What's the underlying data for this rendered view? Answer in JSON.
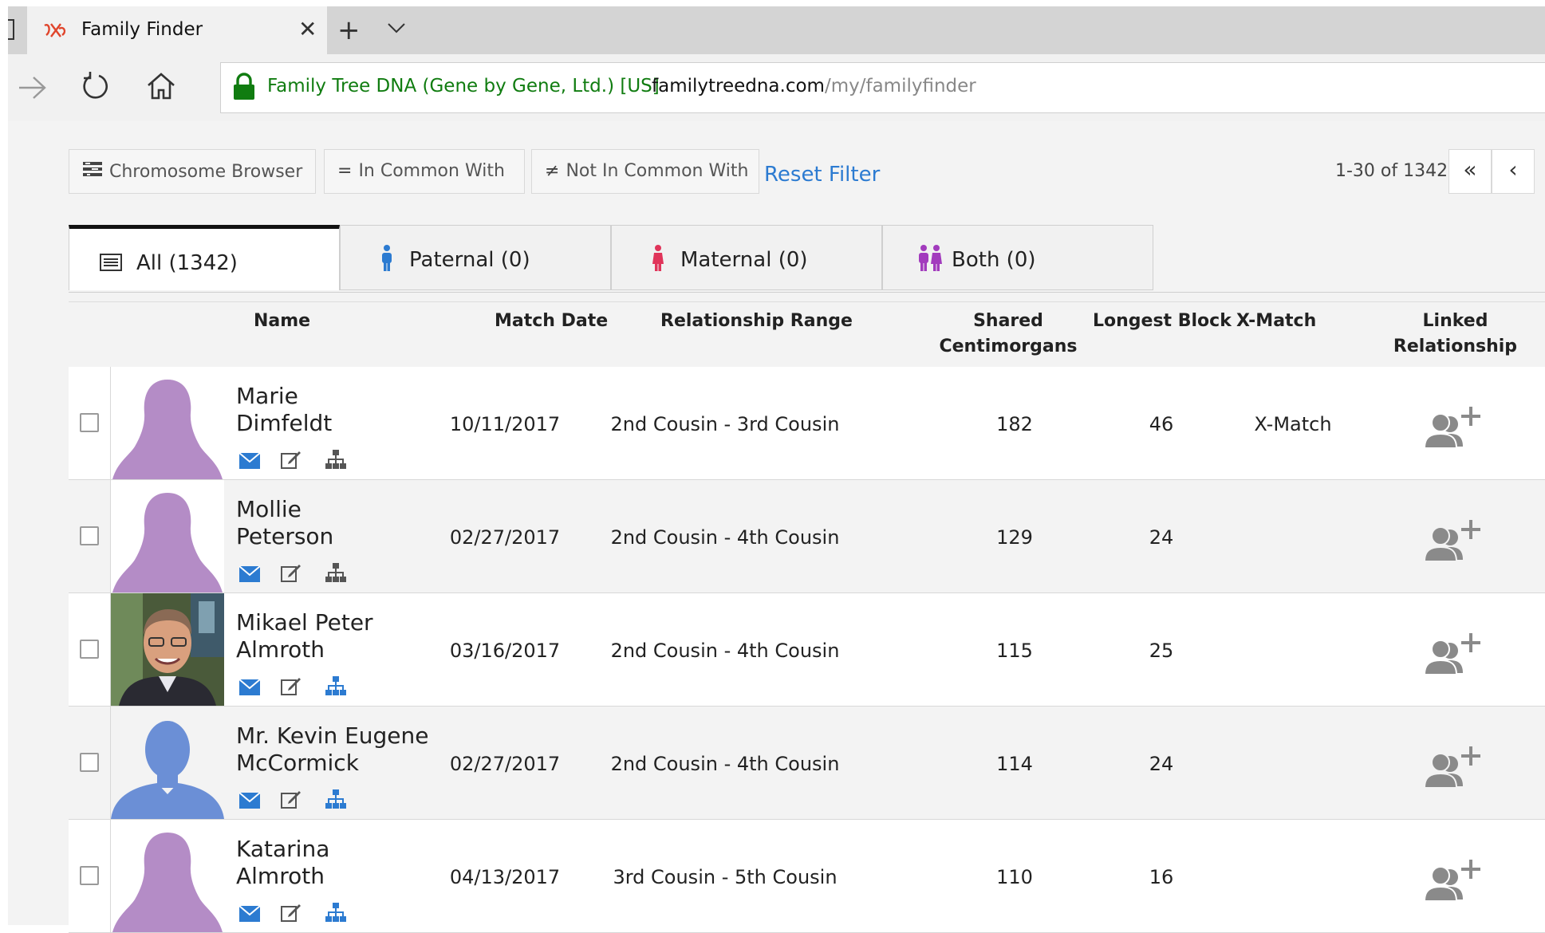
{
  "browser": {
    "tab_title": "Family Finder",
    "tab_close": "✕",
    "new_tab": "+",
    "cert_label": "Family Tree DNA (Gene by Gene, Ltd.) [US]",
    "url_domain": "familytreedna.com",
    "url_path": "/my/familyfinder"
  },
  "toolbar": {
    "chromosome_browser": "Chromosome Browser",
    "in_common_with": "In Common With",
    "not_in_common_with": "Not In Common With",
    "reset_filter": "Reset Filter",
    "in_common_symbol": "=",
    "not_in_common_symbol": "≠"
  },
  "pager": {
    "range_text": "1-30 of 1342",
    "first": "«",
    "prev": "‹"
  },
  "filter_tabs": [
    {
      "label": "All (1342)"
    },
    {
      "label": "Paternal (0)"
    },
    {
      "label": "Maternal (0)"
    },
    {
      "label": "Both (0)"
    }
  ],
  "columns": {
    "name": "Name",
    "match_date": "Match Date",
    "relationship_range": "Relationship Range",
    "shared_cm_line1": "Shared",
    "shared_cm_line2": "Centimorgans",
    "longest_block": "Longest Block",
    "x_match": "X-Match",
    "linked_relationship": "Linked Relationship"
  },
  "matches": [
    {
      "first": "Marie",
      "last": "Dimfeldt",
      "date": "10/11/2017",
      "range": "2nd Cousin - 3rd Cousin",
      "shared_cm": "182",
      "longest_block": "46",
      "x_match": "X-Match",
      "avatar": "female-silhouette"
    },
    {
      "first": "Mollie",
      "last": "Peterson",
      "date": "02/27/2017",
      "range": "2nd Cousin - 4th Cousin",
      "shared_cm": "129",
      "longest_block": "24",
      "x_match": "",
      "avatar": "female-silhouette"
    },
    {
      "first": "Mikael Peter",
      "last": "Almroth",
      "date": "03/16/2017",
      "range": "2nd Cousin - 4th Cousin",
      "shared_cm": "115",
      "longest_block": "25",
      "x_match": "",
      "avatar": "photo"
    },
    {
      "first": "Mr. Kevin Eugene",
      "last": "McCormick",
      "date": "02/27/2017",
      "range": "2nd Cousin - 4th Cousin",
      "shared_cm": "114",
      "longest_block": "24",
      "x_match": "",
      "avatar": "male-silhouette"
    },
    {
      "first": "Katarina",
      "last": "Almroth",
      "date": "04/13/2017",
      "range": "3rd Cousin - 5th Cousin",
      "shared_cm": "110",
      "longest_block": "16",
      "x_match": "",
      "avatar": "female-silhouette"
    }
  ],
  "colors": {
    "female_avatar": "#b48cc6",
    "male_avatar": "#6b8fd6",
    "accent_blue": "#2c7bd1",
    "cert_green": "#107c10",
    "paternal_icon": "#2c7bd1",
    "maternal_icon": "#e0345a",
    "both_icon": "#a23bbd"
  }
}
